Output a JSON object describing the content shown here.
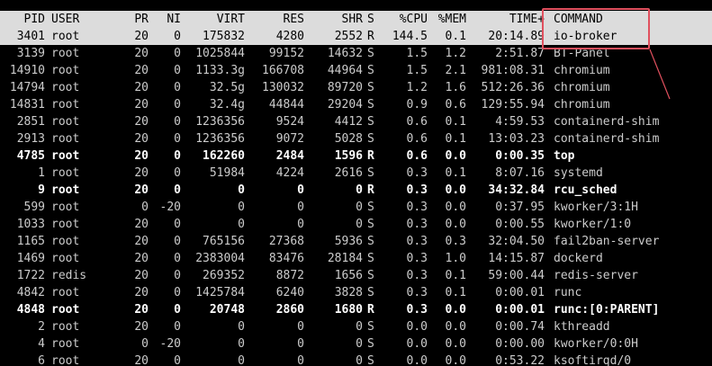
{
  "columns": {
    "pid": "PID",
    "user": "USER",
    "pr": "PR",
    "ni": "NI",
    "virt": "VIRT",
    "res": "RES",
    "shr": "SHR",
    "s": "S",
    "cpu": "%CPU",
    "mem": "%MEM",
    "time": "TIME+",
    "command": "COMMAND"
  },
  "processes": [
    {
      "pid": "3401",
      "user": "root",
      "pr": "20",
      "ni": "0",
      "virt": "175832",
      "res": "4280",
      "shr": "2552",
      "s": "R",
      "cpu": "144.5",
      "mem": "0.1",
      "time": "20:14.89",
      "command": "io-broker"
    },
    {
      "pid": "3139",
      "user": "root",
      "pr": "20",
      "ni": "0",
      "virt": "1025844",
      "res": "99152",
      "shr": "14632",
      "s": "S",
      "cpu": "1.5",
      "mem": "1.2",
      "time": "2:51.87",
      "command": "BT-Panel"
    },
    {
      "pid": "14910",
      "user": "root",
      "pr": "20",
      "ni": "0",
      "virt": "1133.3g",
      "res": "166708",
      "shr": "44964",
      "s": "S",
      "cpu": "1.5",
      "mem": "2.1",
      "time": "981:08.31",
      "command": "chromium"
    },
    {
      "pid": "14794",
      "user": "root",
      "pr": "20",
      "ni": "0",
      "virt": "32.5g",
      "res": "130032",
      "shr": "89720",
      "s": "S",
      "cpu": "1.2",
      "mem": "1.6",
      "time": "512:26.36",
      "command": "chromium"
    },
    {
      "pid": "14831",
      "user": "root",
      "pr": "20",
      "ni": "0",
      "virt": "32.4g",
      "res": "44844",
      "shr": "29204",
      "s": "S",
      "cpu": "0.9",
      "mem": "0.6",
      "time": "129:55.94",
      "command": "chromium"
    },
    {
      "pid": "2851",
      "user": "root",
      "pr": "20",
      "ni": "0",
      "virt": "1236356",
      "res": "9524",
      "shr": "4412",
      "s": "S",
      "cpu": "0.6",
      "mem": "0.1",
      "time": "4:59.53",
      "command": "containerd-shim"
    },
    {
      "pid": "2913",
      "user": "root",
      "pr": "20",
      "ni": "0",
      "virt": "1236356",
      "res": "9072",
      "shr": "5028",
      "s": "S",
      "cpu": "0.6",
      "mem": "0.1",
      "time": "13:03.23",
      "command": "containerd-shim"
    },
    {
      "pid": "4785",
      "user": "root",
      "pr": "20",
      "ni": "0",
      "virt": "162260",
      "res": "2484",
      "shr": "1596",
      "s": "R",
      "cpu": "0.6",
      "mem": "0.0",
      "time": "0:00.35",
      "command": "top"
    },
    {
      "pid": "1",
      "user": "root",
      "pr": "20",
      "ni": "0",
      "virt": "51984",
      "res": "4224",
      "shr": "2616",
      "s": "S",
      "cpu": "0.3",
      "mem": "0.1",
      "time": "8:07.16",
      "command": "systemd"
    },
    {
      "pid": "9",
      "user": "root",
      "pr": "20",
      "ni": "0",
      "virt": "0",
      "res": "0",
      "shr": "0",
      "s": "R",
      "cpu": "0.3",
      "mem": "0.0",
      "time": "34:32.84",
      "command": "rcu_sched"
    },
    {
      "pid": "599",
      "user": "root",
      "pr": "0",
      "ni": "-20",
      "virt": "0",
      "res": "0",
      "shr": "0",
      "s": "S",
      "cpu": "0.3",
      "mem": "0.0",
      "time": "0:37.95",
      "command": "kworker/3:1H"
    },
    {
      "pid": "1033",
      "user": "root",
      "pr": "20",
      "ni": "0",
      "virt": "0",
      "res": "0",
      "shr": "0",
      "s": "S",
      "cpu": "0.3",
      "mem": "0.0",
      "time": "0:00.55",
      "command": "kworker/1:0"
    },
    {
      "pid": "1165",
      "user": "root",
      "pr": "20",
      "ni": "0",
      "virt": "765156",
      "res": "27368",
      "shr": "5936",
      "s": "S",
      "cpu": "0.3",
      "mem": "0.3",
      "time": "32:04.50",
      "command": "fail2ban-server"
    },
    {
      "pid": "1469",
      "user": "root",
      "pr": "20",
      "ni": "0",
      "virt": "2383004",
      "res": "83476",
      "shr": "28184",
      "s": "S",
      "cpu": "0.3",
      "mem": "1.0",
      "time": "14:15.87",
      "command": "dockerd"
    },
    {
      "pid": "1722",
      "user": "redis",
      "pr": "20",
      "ni": "0",
      "virt": "269352",
      "res": "8872",
      "shr": "1656",
      "s": "S",
      "cpu": "0.3",
      "mem": "0.1",
      "time": "59:00.44",
      "command": "redis-server"
    },
    {
      "pid": "4842",
      "user": "root",
      "pr": "20",
      "ni": "0",
      "virt": "1425784",
      "res": "6240",
      "shr": "3828",
      "s": "S",
      "cpu": "0.3",
      "mem": "0.1",
      "time": "0:00.01",
      "command": "runc"
    },
    {
      "pid": "4848",
      "user": "root",
      "pr": "20",
      "ni": "0",
      "virt": "20748",
      "res": "2860",
      "shr": "1680",
      "s": "R",
      "cpu": "0.3",
      "mem": "0.0",
      "time": "0:00.01",
      "command": "runc:[0:PARENT]"
    },
    {
      "pid": "2",
      "user": "root",
      "pr": "20",
      "ni": "0",
      "virt": "0",
      "res": "0",
      "shr": "0",
      "s": "S",
      "cpu": "0.0",
      "mem": "0.0",
      "time": "0:00.74",
      "command": "kthreadd"
    },
    {
      "pid": "4",
      "user": "root",
      "pr": "0",
      "ni": "-20",
      "virt": "0",
      "res": "0",
      "shr": "0",
      "s": "S",
      "cpu": "0.0",
      "mem": "0.0",
      "time": "0:00.00",
      "command": "kworker/0:0H"
    },
    {
      "pid": "6",
      "user": "root",
      "pr": "20",
      "ni": "0",
      "virt": "0",
      "res": "0",
      "shr": "0",
      "s": "S",
      "cpu": "0.0",
      "mem": "0.0",
      "time": "0:53.22",
      "command": "ksoftirqd/0"
    }
  ],
  "selected_row": 0,
  "annotation": {
    "highlighted_column": "command",
    "box_color": "#e0505e"
  },
  "colors": {
    "background": "#000000",
    "text": "#cccccc",
    "bold_text": "#ffffff",
    "header_background": "#dcdcdc",
    "header_text": "#000000"
  }
}
